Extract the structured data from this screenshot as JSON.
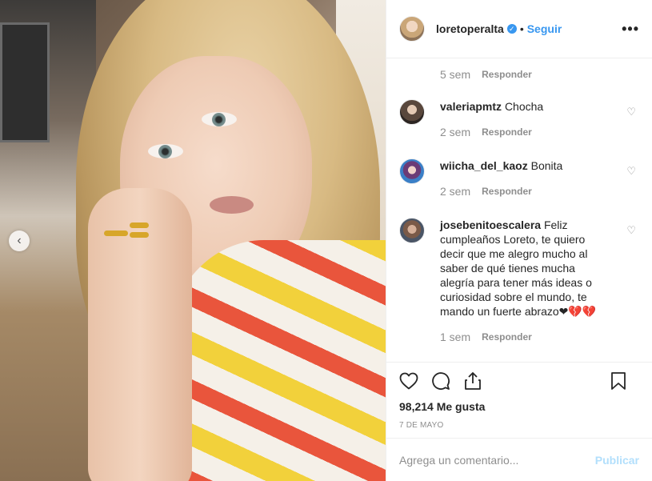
{
  "post": {
    "username": "loretoperalta",
    "verified": true,
    "separator": "•",
    "follow_label": "Seguir",
    "more_icon": "more-options-icon",
    "more_label": "•••"
  },
  "first_comment_meta": {
    "time": "5 sem",
    "reply_label": "Responder"
  },
  "comments": [
    {
      "username": "valeriapmtz",
      "text": "Chocha",
      "time": "2 sem",
      "reply_label": "Responder"
    },
    {
      "username": "wiicha_del_kaoz",
      "text": "Bonita",
      "time": "2 sem",
      "reply_label": "Responder"
    },
    {
      "username": "josebenitoescalera",
      "text": "Feliz cumpleaños Loreto, te quiero decir que me alegro mucho al saber de qué tienes mucha alegría para tener más ideas o curiosidad sobre el mundo, te mando un fuerte abrazo❤💔💔",
      "time": "1 sem",
      "reply_label": "Responder"
    }
  ],
  "actions": {
    "likes": "98,214 Me gusta",
    "date": "7 DE MAYO"
  },
  "add_comment": {
    "placeholder": "Agrega un comentario...",
    "publish_label": "Publicar"
  },
  "colors": {
    "accent": "#3897f0",
    "muted": "#8e8e8e",
    "text": "#262626",
    "publish_disabled": "#b2dffc"
  }
}
